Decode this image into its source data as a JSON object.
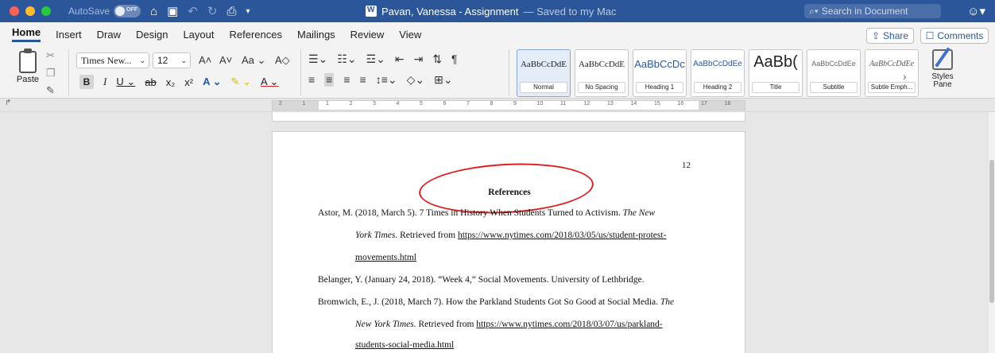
{
  "titlebar": {
    "autosave": "AutoSave",
    "autosave_state": "OFF",
    "doc_name": "Pavan, Vanessa - Assignment",
    "doc_status": "— Saved to my Mac",
    "search_placeholder": "Search in Document"
  },
  "tabs": [
    "Home",
    "Insert",
    "Draw",
    "Design",
    "Layout",
    "References",
    "Mailings",
    "Review",
    "View"
  ],
  "actions": {
    "share": "Share",
    "comments": "Comments"
  },
  "clipboard": {
    "paste": "Paste"
  },
  "font": {
    "name": "Times New...",
    "size": "12"
  },
  "styles": [
    {
      "sample": "AaBbCcDdE",
      "name": "Normal"
    },
    {
      "sample": "AaBbCcDdE",
      "name": "No Spacing"
    },
    {
      "sample": "AaBbCcDc",
      "name": "Heading 1"
    },
    {
      "sample": "AaBbCcDdEe",
      "name": "Heading 2"
    },
    {
      "sample": "AaBb(",
      "name": "Title"
    },
    {
      "sample": "AaBbCcDdEe",
      "name": "Subtitle"
    },
    {
      "sample": "AaBbCcDdEe",
      "name": "Subtle Emph..."
    }
  ],
  "styles_pane": {
    "line1": "Styles",
    "line2": "Pane"
  },
  "ruler": {
    "numbers": [
      "2",
      "1",
      "1",
      "2",
      "3",
      "4",
      "5",
      "6",
      "7",
      "8",
      "9",
      "10",
      "11",
      "12",
      "13",
      "14",
      "15",
      "16",
      "17",
      "18"
    ]
  },
  "document": {
    "page_number": "12",
    "heading": "References",
    "refs": {
      "astor_l1": "Astor, M. (2018, March 5). 7 Times in History When Students Turned to Activism. ",
      "astor_l1_ital": "The New",
      "astor_l2_ital": "York Times",
      "astor_l2": ". Retrieved from ",
      "astor_l2_link": "https://www.nytimes.com/2018/03/05/us/student-protest-",
      "astor_l3_link": "movements.html",
      "belanger": "Belanger, Y. (January 24, 2018). “Week 4,” Social Movements. University of Lethbridge.",
      "bromwich_l1": "Bromwich, E., J. (2018, March 7). How the Parkland Students Got So Good at Social Media. ",
      "bromwich_l1_ital": "The",
      "bromwich_l2_ital": "New York Times.",
      "bromwich_l2": " Retrieved from ",
      "bromwich_l2_link": "https://www.nytimes.com/2018/03/07/us/parkland-",
      "bromwich_l3_link": "students-social-media.html"
    }
  },
  "colors": {
    "titlebar": "#2b579a",
    "annotation": "#d9201f"
  }
}
